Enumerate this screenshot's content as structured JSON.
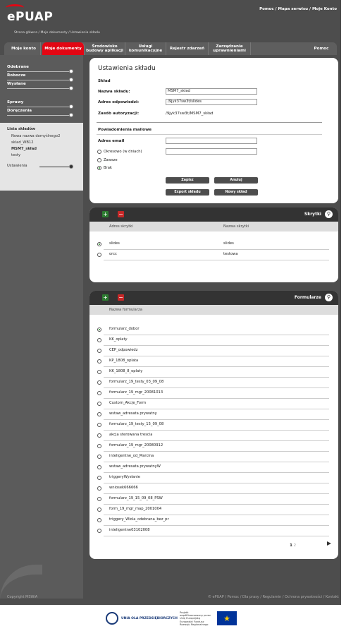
{
  "header": {
    "logo": "ePUAP",
    "top_links": "Pomoc / Mapa serwisu / Moje Konto",
    "breadcrumb": "Strona główna / Moje dokumenty / Ustawienia składu"
  },
  "nav": {
    "items": [
      {
        "label": "Moje konto",
        "active": false
      },
      {
        "label": "Moje dokumenty",
        "active": true
      },
      {
        "label": "Środowisko budowy aplikacji",
        "active": false
      },
      {
        "label": "Usługi komunikacyjne",
        "active": false
      },
      {
        "label": "Rejestr zdarzeń",
        "active": false
      },
      {
        "label": "Zarządzanie uprawnieniami",
        "active": false
      },
      {
        "label": "Pomoc",
        "active": false
      }
    ]
  },
  "sidebar": {
    "groups": [
      {
        "label": "Odebrane"
      },
      {
        "label": "Robocze"
      },
      {
        "label": "Wysłane"
      },
      {
        "label": "Sprawy"
      },
      {
        "label": "Doręczenia"
      }
    ],
    "list_title": "Lista składów",
    "list_items": [
      "Nowa nazwa domyślnego2",
      "sklad_WB12",
      "MSM7_skład",
      "testy"
    ],
    "settings_label": "Ustawienia",
    "copyright": "Copyright MSWiA"
  },
  "settings": {
    "title": "Ustawienia składu",
    "section1": "Skład",
    "name_label": "Nazwa składu:",
    "name_value": "MSM7_skład",
    "address_label": "Adres odpowiedzi:",
    "address_value": "/9jyk37sw3t/slides",
    "auth_label": "Zasób autoryzacji:",
    "auth_value": "/9jyk37sw3t/MSM7_skład",
    "section2": "Powiadomienia mailowe",
    "email_label": "Adres email",
    "email_value": "",
    "period_label": "Okresowo (w dniach)",
    "period_value": "",
    "always_label": "Zawsze",
    "none_label": "Brak",
    "save": "Zapisz",
    "cancel": "Anuluj",
    "export": "Export składu",
    "new": "Nowy skład"
  },
  "scripts_panel": {
    "title": "Skrytki",
    "col_address": "Adres skrytki",
    "col_name": "Nazwa skrytki",
    "rows": [
      {
        "address": "slides",
        "name": "slides",
        "selected": true
      },
      {
        "address": "orcc",
        "name": "testowa",
        "selected": false
      }
    ]
  },
  "forms_panel": {
    "title": "Formularze",
    "col_name": "Nazwa formularza",
    "rows": [
      "formularz_dobor",
      "KK_oplaty",
      "CEP_odpowiedz",
      "KP_1808_oplata",
      "KK_1808_8_oplaty",
      "formularz_19_testy_03_09_08",
      "formularz_19_mgr_20081013",
      "Custom_Akcje_Form",
      "wstaw_adresata prywatny",
      "formularz_19_testy_15_09_08",
      "akcja sterowana trescia",
      "formularz_19_mgr_20080912",
      "inteligentne_od_Marcina",
      "wstaw_adresata prywatnyW",
      "triggeryWysłanie",
      "wniosek666666",
      "formularz_19_15_09_08_PSW",
      "form_19_mgr_map_2001004",
      "triggery_Wiola_odebrana_bez_pr",
      "inteligentne03102008"
    ],
    "selected_index": 0,
    "pages": [
      "1",
      "2"
    ],
    "current_page": "1"
  },
  "footer": {
    "links": "© ePUAP / Pomoc / Dla prasy / Regulamin / Ochrona prywatności / Kontakt",
    "logo_text": "UNIA OLA PRZEDSIĘBIORCZYCH",
    "logo2_text": "Projekt współfinansowany przez Unię Europejską Europejski Fundusz Rozwoju Regionalnego"
  },
  "colors": {
    "accent": "#e30613",
    "dark": "#4d4d4d",
    "panel_head": "#333333"
  }
}
